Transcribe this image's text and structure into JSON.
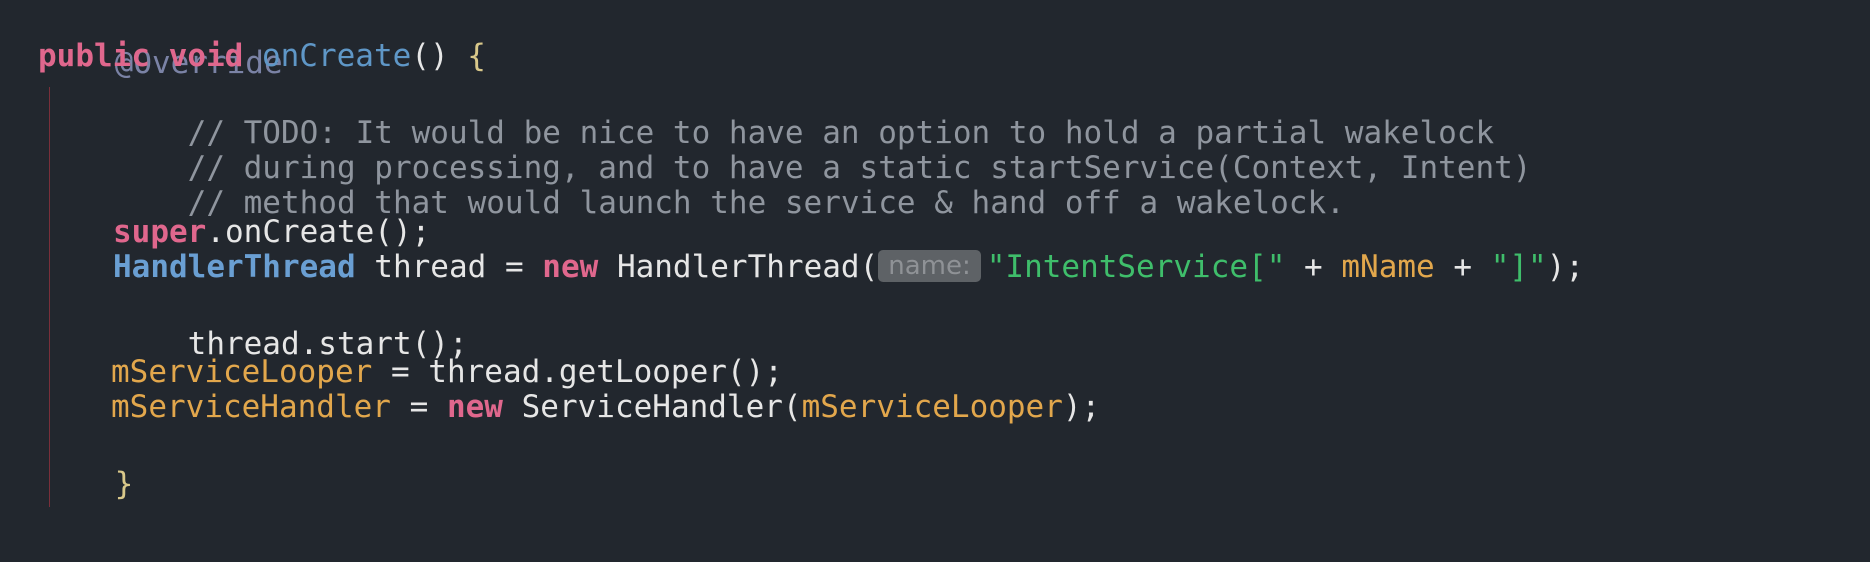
{
  "code": {
    "annotation": "@Override",
    "sig_public": "public",
    "sig_void": "void",
    "sig_method": "onCreate",
    "sig_parens": "() ",
    "sig_brace": "{",
    "comment1": "// TODO: It would be nice to have an option to hold a partial wakelock",
    "comment2": "// during processing, and to have a static startService(Context, Intent)",
    "comment3": "// method that would launch the service & hand off a wakelock.",
    "super_kw": "super",
    "super_call": ".onCreate();",
    "ht_type": "HandlerThread",
    "ht_var": " thread = ",
    "new_kw": "new",
    "ht_ctor": " HandlerThread(",
    "param_hint": "name:",
    "str_open": "\"IntentService[\"",
    "plus1": " + ",
    "mname": "mName",
    "plus2": " + ",
    "str_close": "\"]\"",
    "ht_end": ");",
    "start_call": "thread.start();",
    "looper_field": "mServiceLooper",
    "looper_rest": " = thread.getLooper();",
    "handler_field": "mServiceHandler",
    "handler_eq": " = ",
    "handler_new": "new",
    "handler_ctor": " ServiceHandler(",
    "handler_arg": "mServiceLooper",
    "handler_end": ");",
    "close_brace": "}"
  }
}
